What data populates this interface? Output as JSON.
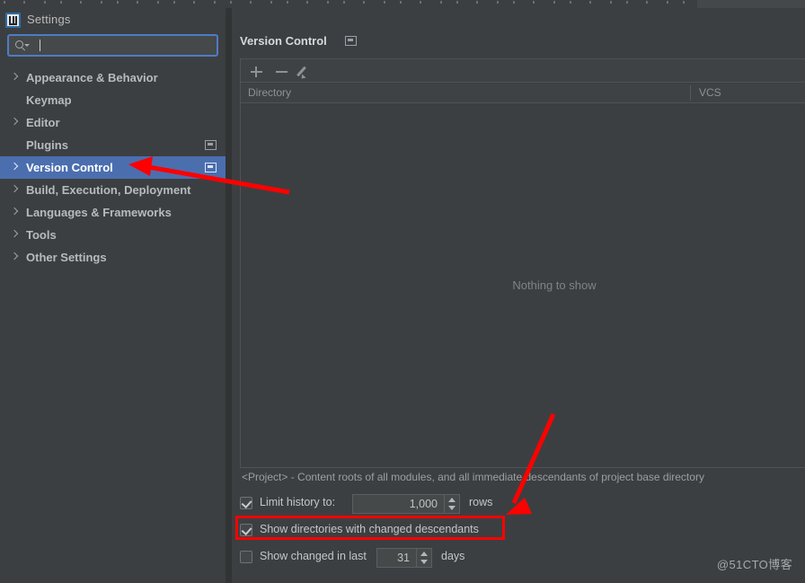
{
  "window": {
    "title": "Settings",
    "logo_icon": "intellij-idea-logo-icon"
  },
  "search": {
    "value": "",
    "placeholder": "",
    "icon": "search-icon",
    "dropdown_icon": "chevron-down-icon"
  },
  "sidebar": {
    "items": [
      {
        "label": "Appearance & Behavior",
        "expandable": true,
        "selected": false,
        "scope_icon": false
      },
      {
        "label": "Keymap",
        "expandable": false,
        "selected": false,
        "scope_icon": false
      },
      {
        "label": "Editor",
        "expandable": true,
        "selected": false,
        "scope_icon": false
      },
      {
        "label": "Plugins",
        "expandable": false,
        "selected": false,
        "scope_icon": true
      },
      {
        "label": "Version Control",
        "expandable": true,
        "selected": true,
        "scope_icon": true
      },
      {
        "label": "Build, Execution, Deployment",
        "expandable": true,
        "selected": false,
        "scope_icon": false
      },
      {
        "label": "Languages & Frameworks",
        "expandable": true,
        "selected": false,
        "scope_icon": false
      },
      {
        "label": "Tools",
        "expandable": true,
        "selected": false,
        "scope_icon": false
      },
      {
        "label": "Other Settings",
        "expandable": true,
        "selected": false,
        "scope_icon": false
      }
    ]
  },
  "main": {
    "section_title": "Version Control",
    "section_scope_icon": "project-scope-icon",
    "toolbar": {
      "add_icon": "plus-icon",
      "remove_icon": "minus-icon",
      "edit_icon": "pencil-icon"
    },
    "table": {
      "columns": [
        "Directory",
        "VCS"
      ],
      "rows": [],
      "empty_text": "Nothing to show"
    },
    "hint": "<Project> - Content roots of all modules, and all immediate descendants of project base directory",
    "options": [
      {
        "label": "Limit history to:",
        "checked": true,
        "value": "1,000",
        "unit": "rows",
        "highlighted": false
      },
      {
        "label": "Show directories with changed descendants",
        "checked": true,
        "value": null,
        "unit": null,
        "highlighted": true
      },
      {
        "label": "Show changed in last",
        "checked": false,
        "value": "31",
        "unit": "days",
        "highlighted": false
      }
    ]
  },
  "annotations": {
    "highlight_color": "#ff0000",
    "arrow_1": "arrow pointing left at Version Control sidebar item",
    "arrow_2": "arrow pointing down-left at Show directories with changed descendants"
  },
  "watermark": "@51CTO博客",
  "colors": {
    "background": "#3c3f41",
    "selection": "#4b6eaf",
    "text": "#b6bbbf",
    "accent_border": "#4e7cc4",
    "annotation_red": "#ff0000"
  }
}
